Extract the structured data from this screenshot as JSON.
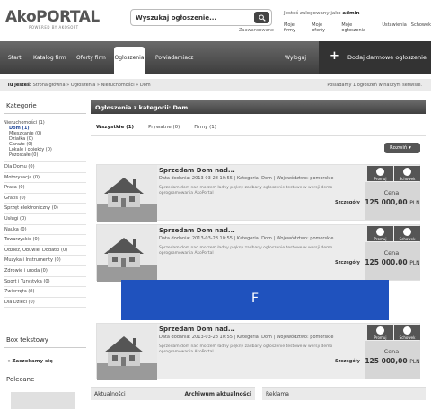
{
  "header": {
    "logo_main": "AkoPORTAL",
    "logo_sub": "POWERED BY AKOSOFT",
    "search_value": "Wyszukaj ogłoszenie...",
    "advanced": "Zaawansowane",
    "user_prefix": "Jesteś zalogowany jako",
    "user_name": "admin",
    "user_menu": [
      "Moje firmy",
      "Moje oferty",
      "Moje ogłoszenia",
      "Ustawienia",
      "Schowek"
    ]
  },
  "nav": {
    "items": [
      "Start",
      "Katalog firm",
      "Oferty firm",
      "Ogłoszenia",
      "Powiadamiacz"
    ],
    "logout": "Wyloguj",
    "cta": "Dodaj darmowe ogłoszenie"
  },
  "breadcrumb": {
    "label": "Tu jesteś:",
    "path": "Strona główna » Ogłoszenia » Nieruchomości » Dom",
    "right": "Posiadamy 1 ogłoszeń w naszym serwisie."
  },
  "sidebar": {
    "categories_title": "Kategorie",
    "categories": [
      "Nieruchomości (1)",
      "Dla Domu (0)",
      "Motoryzacja (0)",
      "Praca (0)",
      "Gratis (0)",
      "Sprzęt elektroniczny (0)",
      "Usługi (0)",
      "Nauka (0)",
      "Towarzyskie (0)",
      "Odzież, Obuwie, Dodatki (0)",
      "Muzyka i Instrumenty (0)",
      "Zdrowie i uroda (0)",
      "Sport i Turystyka (0)",
      "Zwierzęta (0)",
      "Dla Dzieci (0)"
    ],
    "subcategories": [
      "Dom (1)",
      "Mieszkanie (0)",
      "Działka (0)",
      "Garaże (0)",
      "Lokale i obiekty (0)",
      "Pozostałe (0)"
    ],
    "text_box_title": "Box tekstowy",
    "collapse": "« Zaczekamy się",
    "recommended_title": "Polecane"
  },
  "main": {
    "title": "Ogłoszenia z kategorii: Dom",
    "tabs": [
      "Wszystkie (1)",
      "Prywatne (0)",
      "Firmy (1)"
    ],
    "sort": "Rozwiń",
    "listings": [
      {
        "title": "Sprzedam Dom nad...",
        "meta": "Data dodania: 2013-03-28 10:55 | Kategoria: Dom | Województwo: pomorskie",
        "desc": "Sprzedam dom nad morzem ładny piękny zadbany ogłoszenie testowe w wersji demo oprogramowania AkoPortal",
        "more": "Szczegóły",
        "promo": "Promuj",
        "save": "Schowek",
        "price_label": "Cena:",
        "price": "125 000,00",
        "currency": "PLN"
      },
      {
        "title": "Sprzedam Dom nad...",
        "meta": "Data dodania: 2013-03-28 10:55 | Kategoria: Dom | Województwo: pomorskie",
        "desc": "Sprzedam dom nad morzem ładny piękny zadbany ogłoszenie testowe w wersji demo oprogramowania AkoPortal",
        "more": "Szczegóły",
        "promo": "Promuj",
        "save": "Schowek",
        "price_label": "Cena:",
        "price": "125 000,00",
        "currency": "PLN"
      },
      {
        "title": "Sprzedam Dom nad...",
        "meta": "Data dodania: 2013-03-28 10:55 | Kategoria: Dom | Województwo: pomorskie",
        "desc": "Sprzedam dom nad morzem ładny piękny zadbany ogłoszenie testowe w wersji demo oprogramowania AkoPortal",
        "more": "Szczegóły",
        "promo": "Promuj",
        "save": "Schowek",
        "price_label": "Cena:",
        "price": "125 000,00",
        "currency": "PLN"
      }
    ],
    "banner_text": "F",
    "banner_color": "#1f52be"
  },
  "bottom": {
    "news": "Aktualności",
    "archive": "Archiwum aktualności",
    "ads": "Reklama"
  }
}
